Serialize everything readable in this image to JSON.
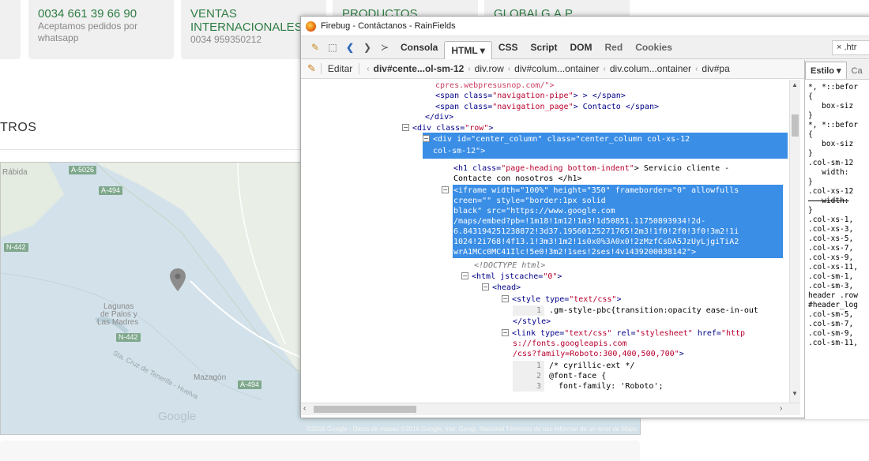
{
  "site": {
    "boxes": [
      {
        "title": "0034 661 39 66 90",
        "sub1": "Aceptamos pedidos por",
        "sub2": "whatsapp"
      },
      {
        "title": "VENTAS",
        "title2": "INTERNACIONALES",
        "sub1": "0034 959350212",
        "sub2": ""
      },
      {
        "title": "PRODUCTOS",
        "title2": "",
        "sub1": "",
        "sub2": ""
      },
      {
        "title": "GLOBALG.A.P.",
        "title2": "",
        "sub1": "",
        "sub2": ""
      }
    ],
    "section_title": "TROS",
    "map": {
      "labels": {
        "rabida": "Rábida",
        "lagunas1": "Lagunas",
        "lagunas2": "de Palos y",
        "lagunas3": "Las Madres",
        "mazagon": "Mazagón",
        "cruz": "Sta. Cruz de Tenerife - Huelva",
        "google": "Google"
      },
      "badges": [
        "A-5026",
        "A-494",
        "N-442",
        "N-442",
        "A-494"
      ],
      "footer": "©2016 Google - Datos de mapas ©2016 Google, Inst. Geogr. Nacional   Términos de uso   Informar de un error de Maps",
      "colors": {
        "water": "#d3e2ea",
        "land": "#e8eee4",
        "pin": "#8c8c8c"
      }
    }
  },
  "firebug": {
    "title": "Firebug - Contáctanos - RainFields",
    "tabs": [
      "Consola",
      "HTML ▾",
      "CSS",
      "Script",
      "DOM",
      "Red",
      "Cookies"
    ],
    "active_tab": "HTML ▾",
    "url_value": "× .htr",
    "edit_label": "Editar",
    "crumbs": [
      "div#cente...ol-sm-12",
      "div.row",
      "div#colum...ontainer",
      "div.colum...ontainer",
      "div#pa"
    ],
    "side_tabs": [
      "Estilo ▾",
      "Ca"
    ],
    "html_lines": {
      "l0": "cpres.webpresusnop.com/\">",
      "l1_tag_open": "<span class=",
      "l1_val": "\"navigation-pipe\"",
      "l1_rest": "> > </span>",
      "l2_tag_open": "<span class=",
      "l2_val": "\"navigation_page\"",
      "l2_rest": "> Contacto </span>",
      "l3": "</div>",
      "l4_open": "<div class=",
      "l4_val": "\"row\"",
      "l4_close": ">",
      "l5a": "<div id=\"center_column\" class=\"center_column col-xs-12",
      "l5b": "col-sm-12\">",
      "l6_open": "<h1 class=",
      "l6_val": "\"page-heading bottom-indent\"",
      "l6_rest": "> Servicio cliente -",
      "l6b": "Contacte con nosotros </h1>",
      "if1": "<iframe width=\"100%\" height=\"350\" frameborder=\"0\" allowfulls",
      "if2": "creen=\"\" style=\"border:1px solid",
      "if3": "black\" src=\"https://www.google.com",
      "if4": "/maps/embed?pb=!1m18!1m12!1m3!1d50851.11750893934!2d-",
      "if5": "6.843194251238872!3d37.19560125271765!2m3!1f0!2f0!3f0!3m2!1i",
      "if6": "1024!2i768!4f13.1!3m3!1m2!1s0x0%3A0x0!2zMzfCsDA5JzUyLjgiTiA2",
      "if7": "wrA1MCc0MC41Ilc!5e0!3m2!1ses!2ses!4v1439200038142\">",
      "doctype": "<!DOCTYPE html>",
      "html_open": "<html jstcache=",
      "html_val": "\"0\"",
      "html_close": ">",
      "head": "<head>",
      "style_open": "<style type=",
      "style_val": "\"text/css\"",
      "style_close": ">",
      "style_ln": "1",
      "style_code": ".gm-style-pbc{transition:opacity ease-in-out",
      "style_end": "</style>",
      "link1_open": "<link type=",
      "link1_val": "\"text/css\"",
      "link1_rel": " rel=",
      "link1_relval": "\"stylesheet\"",
      "link1_href": " href=",
      "link1_hrefval": "\"http",
      "link2": "s://fonts.googleapis.com",
      "link3": "/css?family=Roboto:300,400,500,700\"",
      "link3_close": ">",
      "c1_ln": "1",
      "c1": "/* cyrillic-ext */",
      "c2_ln": "2",
      "c2": "@font-face {",
      "c3_ln": "3",
      "c3": "  font-family: 'Roboto';"
    },
    "css_lines": [
      "*, *::befor",
      "{",
      "   box-siz",
      "}",
      "*, *::befor",
      "{",
      "   box-siz",
      "}",
      ".col-sm-12",
      "   width:",
      "}",
      ".col-xs-12",
      "   width:",
      "}",
      ".col-xs-1,",
      ".col-xs-3,",
      ".col-xs-5,",
      ".col-xs-7,",
      ".col-xs-9,",
      ".col-xs-11,",
      ".col-sm-1,",
      ".col-sm-3,",
      "header .row",
      "#header_log",
      ".col-sm-5,",
      ".col-sm-7,",
      ".col-sm-9,",
      ".col-sm-11,"
    ],
    "struck_css_line": 12
  }
}
